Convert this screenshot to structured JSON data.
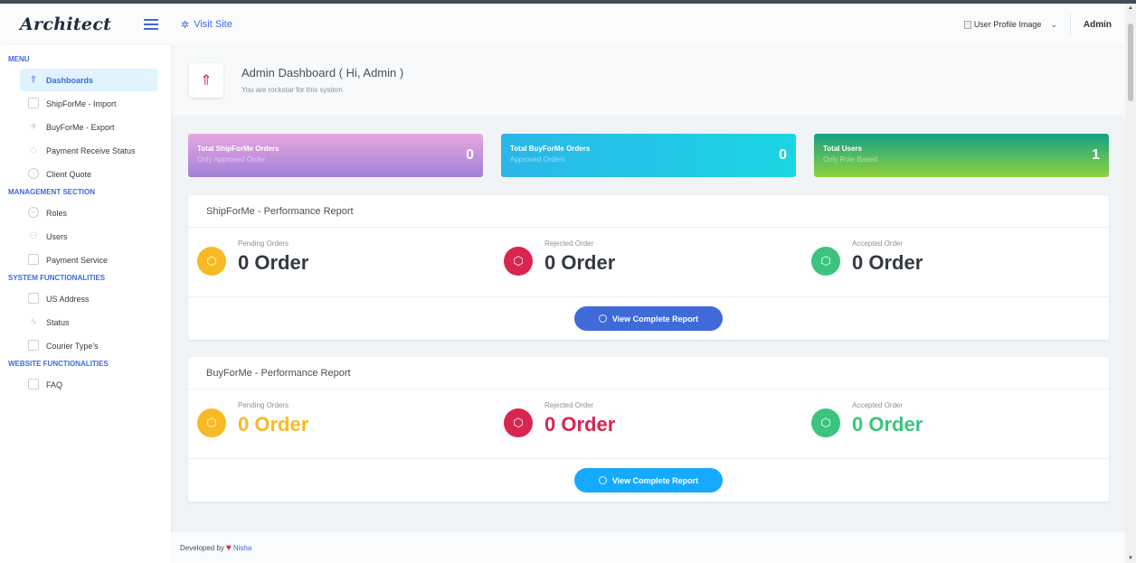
{
  "app": {
    "logo": "Architect"
  },
  "header": {
    "visit_site": "Visit Site",
    "profile_image_alt": "User Profile Image",
    "user_name": "Admin"
  },
  "sidebar": {
    "sections": [
      {
        "heading": "MENU",
        "items": [
          {
            "label": "Dashboards",
            "icon": "rocket-icon"
          },
          {
            "label": "ShipForMe - Import",
            "icon": "box-icon"
          },
          {
            "label": "BuyForMe - Export",
            "icon": "plane-icon"
          },
          {
            "label": "Payment Receive Status",
            "icon": "diamond-icon"
          },
          {
            "label": "Client Quote",
            "icon": "arrow-circle-icon"
          }
        ]
      },
      {
        "heading": "MANAGEMENT SECTION",
        "items": [
          {
            "label": "Roles",
            "icon": "check-circle-icon"
          },
          {
            "label": "Users",
            "icon": "users-icon"
          },
          {
            "label": "Payment Service",
            "icon": "card-icon"
          }
        ]
      },
      {
        "heading": "SYSTEM FUNCTIONALITIES",
        "items": [
          {
            "label": "US Address",
            "icon": "address-icon"
          },
          {
            "label": "Status",
            "icon": "bolt-icon"
          },
          {
            "label": "Courier Type's",
            "icon": "browser-icon"
          }
        ]
      },
      {
        "heading": "WEBSITE FUNCTIONALITIES",
        "items": [
          {
            "label": "FAQ",
            "icon": "chat-icon"
          }
        ]
      }
    ]
  },
  "page": {
    "title": "Admin Dashboard ( Hi, Admin )",
    "subtitle": "You are rockstar for this system"
  },
  "widgets": [
    {
      "title": "Total ShipForMe Orders",
      "subtitle": "Only Approved Order",
      "value": "0"
    },
    {
      "title": "Total BuyForMe Orders",
      "subtitle": "Approved Orders",
      "value": "0"
    },
    {
      "title": "Total Users",
      "subtitle": "Only Role Based",
      "value": "1"
    }
  ],
  "reports": [
    {
      "title": "ShipForMe - Performance Report",
      "stats": [
        {
          "label": "Pending Orders",
          "value": "0 Order"
        },
        {
          "label": "Rejected Order",
          "value": "0 Order"
        },
        {
          "label": "Accepted Order",
          "value": "0 Order"
        }
      ],
      "button": "View Complete Report"
    },
    {
      "title": "BuyForMe - Performance Report",
      "stats": [
        {
          "label": "Pending Orders",
          "value": "0 Order"
        },
        {
          "label": "Rejected Order",
          "value": "0 Order"
        },
        {
          "label": "Accepted Order",
          "value": "0 Order"
        }
      ],
      "button": "View Complete Report"
    }
  ],
  "footer": {
    "prefix": "Developed by",
    "developer": "Nisha"
  },
  "colors": {
    "primary": "#3f6ad8",
    "warning": "#f7b924",
    "danger": "#d92550",
    "success": "#3ac47d",
    "info": "#16aaff"
  }
}
